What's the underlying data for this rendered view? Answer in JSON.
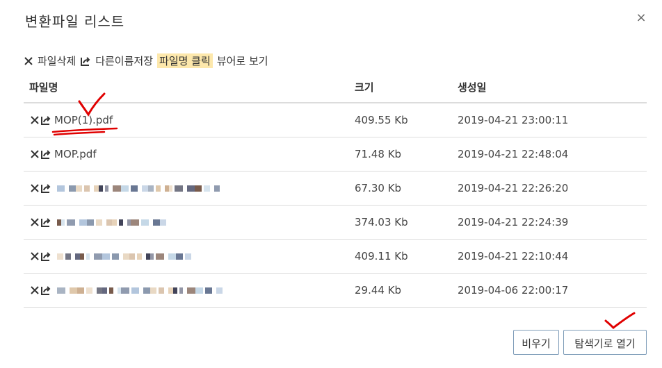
{
  "dialog": {
    "title": "변환파일 리스트",
    "close_glyph": "×"
  },
  "legend": {
    "delete_label": "파일삭제",
    "saveas_label": "다른이름저장",
    "click_highlight": "파일명 클릭",
    "viewer_label": "뷰어로 보기"
  },
  "table": {
    "headers": {
      "name": "파일명",
      "size": "크기",
      "created": "생성일"
    },
    "rows": [
      {
        "name": "MOP(1).pdf",
        "size": "409.55 Kb",
        "created": "2019-04-21 23:00:11",
        "blurred": false
      },
      {
        "name": "MOP.pdf",
        "size": "71.48 Kb",
        "created": "2019-04-21 22:48:04",
        "blurred": false
      },
      {
        "name": "",
        "size": "67.30 Kb",
        "created": "2019-04-21 22:26:20",
        "blurred": true
      },
      {
        "name": "",
        "size": "374.03 Kb",
        "created": "2019-04-21 22:24:39",
        "blurred": true
      },
      {
        "name": "",
        "size": "409.11 Kb",
        "created": "2019-04-21 22:10:44",
        "blurred": true
      },
      {
        "name": "",
        "size": "29.44 Kb",
        "created": "2019-04-06 22:00:17",
        "blurred": true
      }
    ]
  },
  "footer": {
    "clear_label": "비우기",
    "explorer_label": "탐색기로 열기"
  },
  "icons": {
    "delete": "close-x-icon",
    "saveas": "share-export-icon"
  },
  "colors": {
    "highlight": "#fde8ac",
    "annotation": "#e00000",
    "border": "#dcdcdc"
  }
}
